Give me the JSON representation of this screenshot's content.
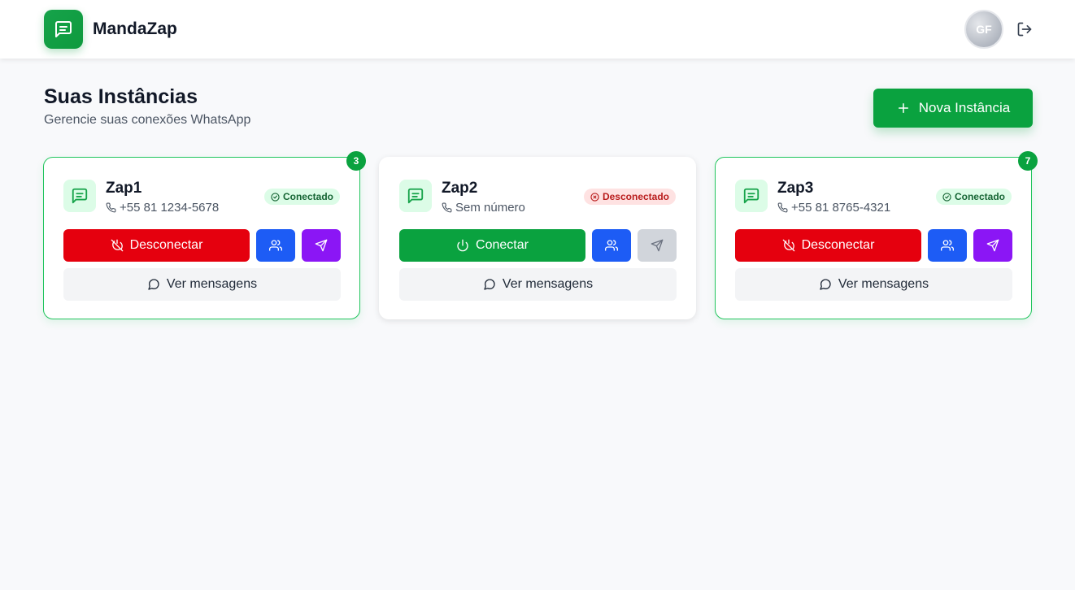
{
  "app": {
    "name": "MandaZap",
    "user_initials": "GF"
  },
  "page": {
    "title": "Suas Instâncias",
    "subtitle": "Gerencie suas conexões WhatsApp",
    "new_button_label": "Nova Instância"
  },
  "colors": {
    "brand_green": "#0aa23f",
    "disconnect_red": "#e5000e",
    "groups_blue": "#1d5cf5",
    "send_purple": "#8b16f5"
  },
  "instances": [
    {
      "name": "Zap1",
      "phone": "+55 81 1234-5678",
      "status": "Conectado",
      "unread": "3",
      "main_action": "Desconectar",
      "view_label": "Ver mensagens"
    },
    {
      "name": "Zap2",
      "phone": "Sem número",
      "status": "Desconectado",
      "unread": "",
      "main_action": "Conectar",
      "view_label": "Ver mensagens"
    },
    {
      "name": "Zap3",
      "phone": "+55 81 8765-4321",
      "status": "Conectado",
      "unread": "7",
      "main_action": "Desconectar",
      "view_label": "Ver mensagens"
    }
  ],
  "icons": {
    "logo": "message-square-icon",
    "logout": "log-out-icon",
    "add": "plus-icon",
    "instance": "message-square-icon",
    "phone": "phone-icon",
    "status_ok": "check-circle-icon",
    "status_bad": "x-circle-icon",
    "disconnect": "power-off-icon",
    "connect": "power-icon",
    "groups": "users-icon",
    "send": "send-icon",
    "messages": "message-circle-icon"
  }
}
